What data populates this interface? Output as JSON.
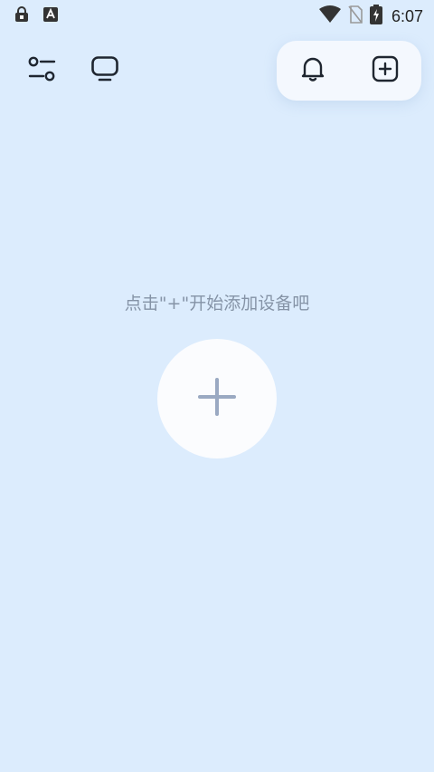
{
  "status_bar": {
    "time": "6:07",
    "icons_left": [
      "lock-app-icon",
      "font-a-icon"
    ],
    "icons_right": [
      "wifi-icon",
      "no-sim-icon",
      "battery-charging-icon"
    ]
  },
  "toolbar": {
    "left_icons": [
      "filter-settings-icon",
      "device-screen-icon"
    ],
    "right_icons": [
      "bell-icon",
      "add-square-icon"
    ]
  },
  "empty_state": {
    "message": "点击\"+\"开始添加设备吧",
    "add_icon": "plus-icon"
  },
  "colors": {
    "background": "#dcecfd",
    "card": "#f4f8fe",
    "text_muted": "#8593a6",
    "plus": "#9aa9c2",
    "icon_dark": "#1f2630"
  }
}
